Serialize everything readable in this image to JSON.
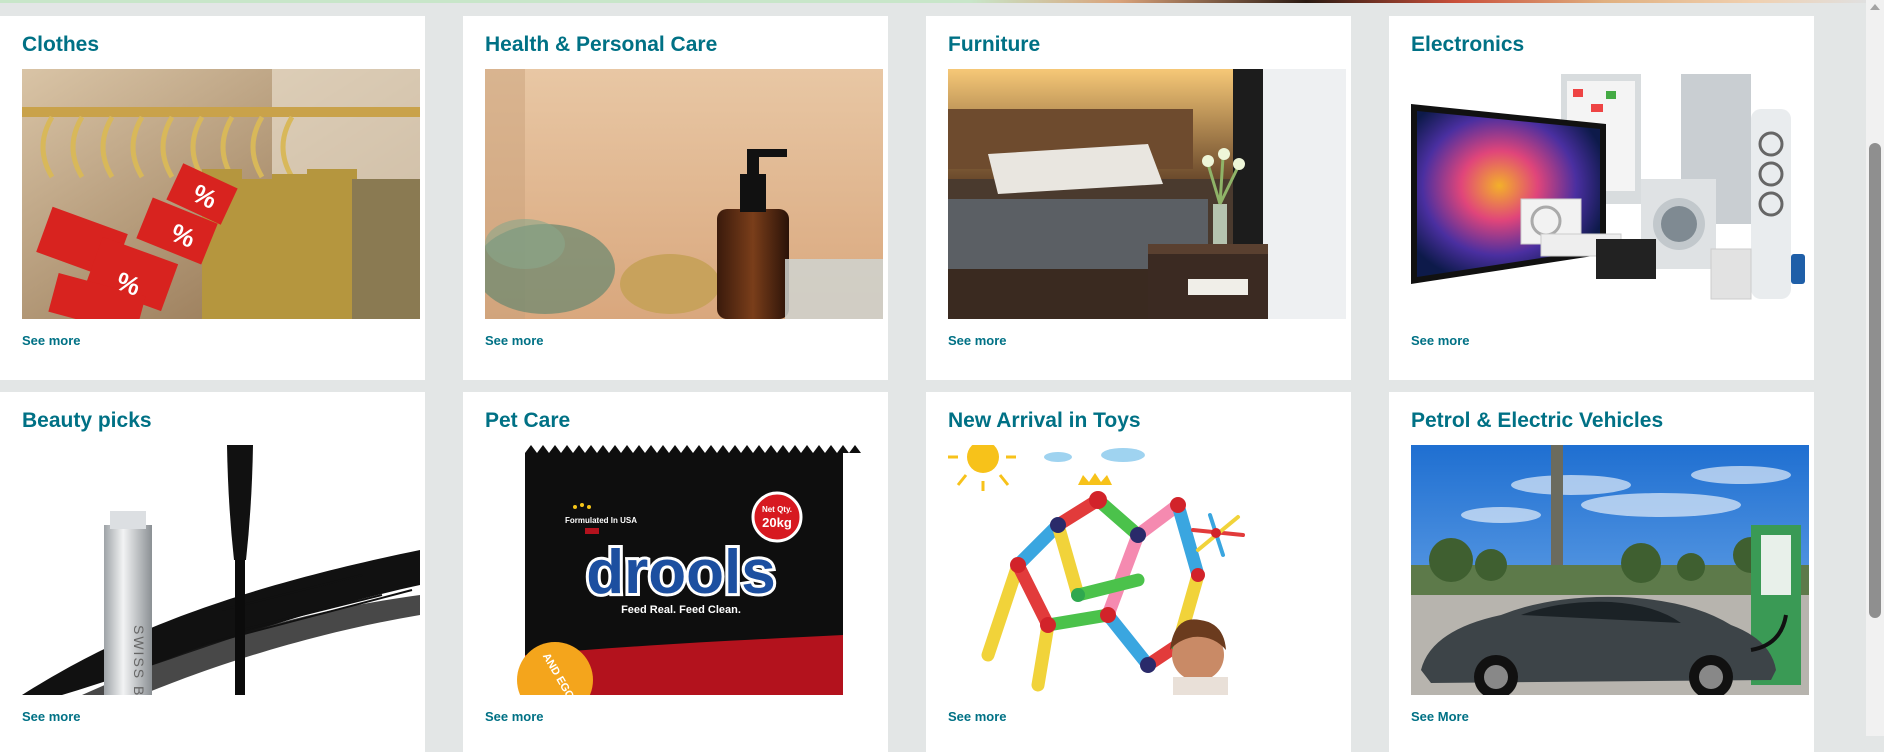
{
  "categories": [
    {
      "title": "Clothes",
      "link": "See more",
      "image_icon": "clothes-rack-sale-icon"
    },
    {
      "title": "Health & Personal Care",
      "link": "See more",
      "image_icon": "pump-bottle-icon"
    },
    {
      "title": "Furniture",
      "link": "See more",
      "image_icon": "bed-nightstand-icon"
    },
    {
      "title": "Electronics",
      "link": "See more",
      "image_icon": "appliances-tv-icon"
    },
    {
      "title": "Beauty picks",
      "link": "See more",
      "image_icon": "mascara-icon"
    },
    {
      "title": "Pet Care",
      "link": "See more",
      "image_icon": "pet-food-bag-icon"
    },
    {
      "title": "New Arrival in Toys",
      "link": "See more",
      "image_icon": "magnetic-toy-icon"
    },
    {
      "title": "Petrol & Electric Vehicles",
      "link": "See More",
      "image_icon": "electric-car-icon"
    }
  ],
  "images": {
    "pet_bag_brand": "drools",
    "pet_bag_tagline": "Feed Real. Feed Clean.",
    "pet_bag_origin": "Formulated In USA",
    "pet_bag_badge_line1": "Net Qty.",
    "pet_bag_badge_line2": "20kg",
    "pet_bag_side": "AND EGG",
    "mascara_brand": "SWISS B"
  },
  "colors": {
    "page_bg": "#e3e6e6",
    "card_bg": "#ffffff",
    "link_teal": "#007185"
  }
}
